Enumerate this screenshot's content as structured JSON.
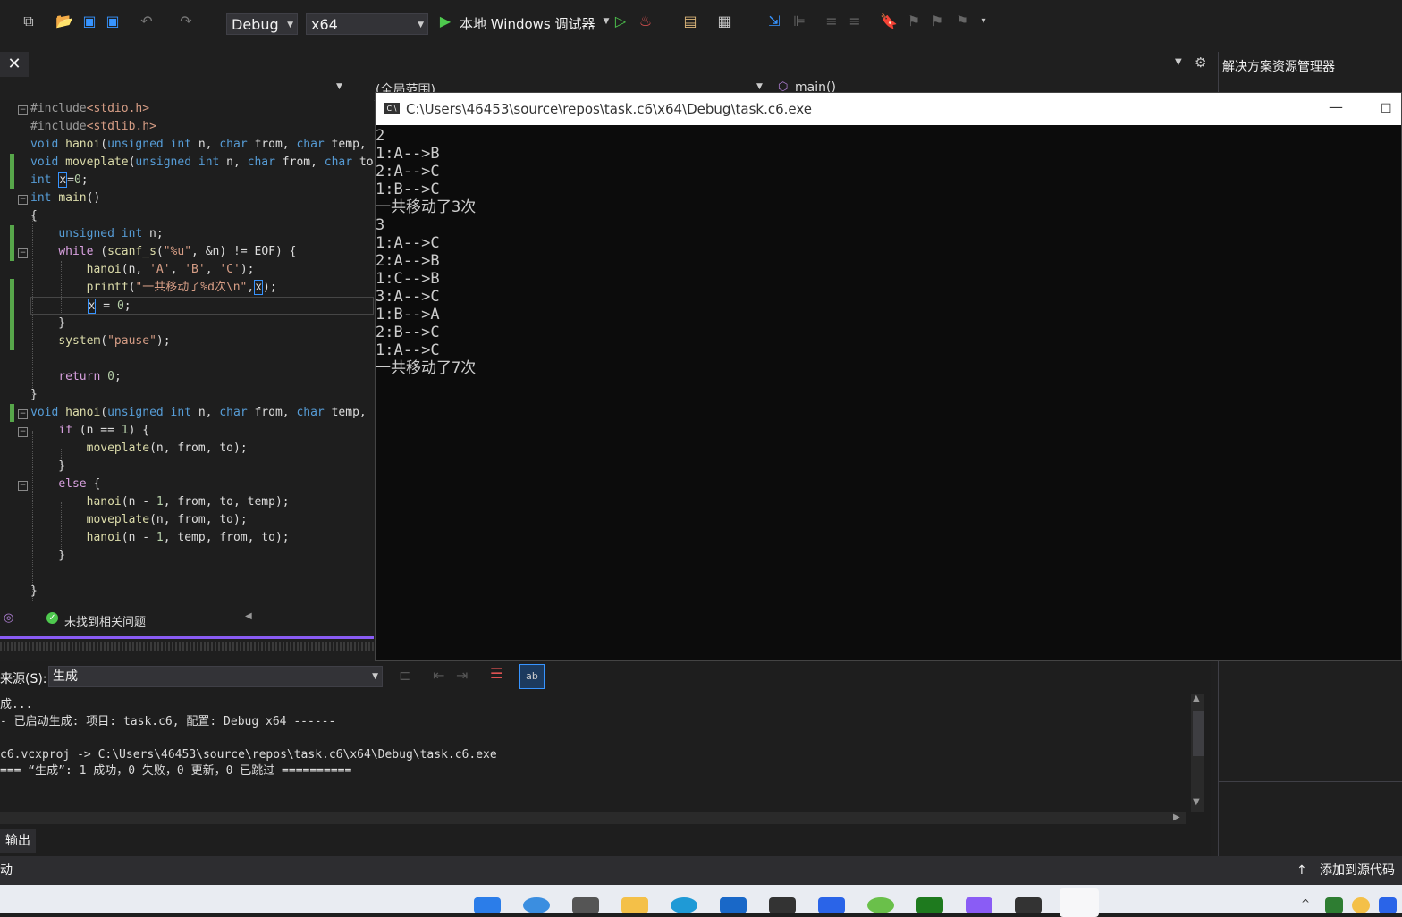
{
  "toolbar": {
    "configuration": "Debug",
    "platform": "x64",
    "run_label": "本地 Windows 调试器"
  },
  "navbar": {
    "scope": "(全局范围)",
    "function": "main()"
  },
  "solution_explorer": {
    "title": "解决方案资源管理器"
  },
  "editor": {
    "status": "未找到相关问题"
  },
  "console": {
    "title": "C:\\Users\\46453\\source\\repos\\task.c6\\x64\\Debug\\task.c6.exe",
    "output": "2\n1:A-->B\n2:A-->C\n1:B-->C\n一共移动了3次\n3\n1:A-->C\n2:A-->B\n1:C-->B\n3:A-->C\n1:B-->A\n2:B-->C\n1:A-->C\n一共移动了7次"
  },
  "output_panel": {
    "source_label": "来源(S):",
    "source_value": "生成",
    "lines": "成...\n- 已启动生成: 项目: task.c6, 配置: Debug x64 ------\n\nc6.vcxproj -> C:\\Users\\46453\\source\\repos\\task.c6\\x64\\Debug\\task.c6.exe\n=== “生成”: 1 成功，0 失败，0 更新，0 已跳过 ==========",
    "tab_label": "输出"
  },
  "statusbar": {
    "left": "动",
    "right": "添加到源代码"
  },
  "colors": {
    "accent_purple": "#8a5cf5",
    "green_change": "#57a64a",
    "run_green": "#4ec94e"
  }
}
